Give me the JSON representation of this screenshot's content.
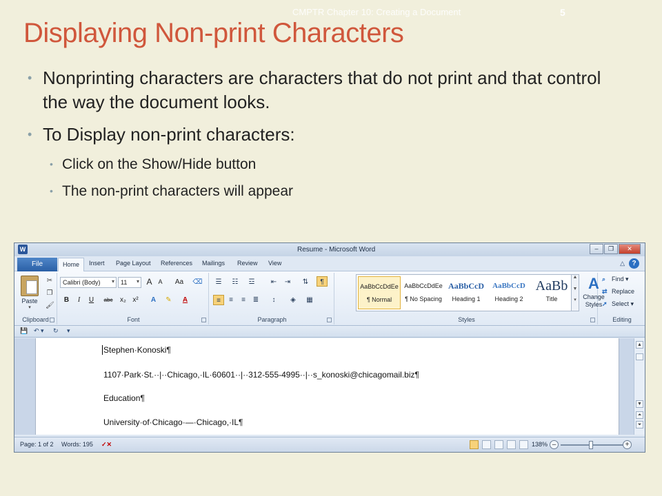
{
  "slide": {
    "footer": "CMPTR Chapter 10: Creating a Document",
    "page_number": "5",
    "title": "Displaying Non-print Characters",
    "bullets": [
      "Nonprinting characters are characters that do not print and that control the way the document looks.",
      "To Display non-print characters:"
    ],
    "sub_bullets": [
      "Click on the Show/Hide button",
      "The non-print characters will appear"
    ]
  },
  "word": {
    "app_icon_letter": "W",
    "title": "Resume - Microsoft Word",
    "tabs": {
      "file": "File",
      "home": "Home",
      "insert": "Insert",
      "page_layout": "Page Layout",
      "references": "References",
      "mailings": "Mailings",
      "review": "Review",
      "view": "View"
    },
    "ribbon": {
      "clipboard": {
        "label": "Clipboard",
        "paste": "Paste"
      },
      "font": {
        "label": "Font",
        "font_name": "Calibri (Body)",
        "font_size": "11",
        "grow": "A",
        "shrink": "A",
        "change_case": "Aa",
        "bold": "B",
        "italic": "I",
        "underline": "U",
        "strikethrough": "abc",
        "subscript": "x₂",
        "superscript": "x²",
        "text_effects": "A",
        "font_color": "A"
      },
      "paragraph": {
        "label": "Paragraph",
        "show_hide": "¶"
      },
      "styles": {
        "label": "Styles",
        "items": [
          {
            "sample": "AaBbCcDdEe",
            "name": "¶ Normal"
          },
          {
            "sample": "AaBbCcDdEe",
            "name": "¶ No Spacing"
          },
          {
            "sample": "AaBbCcD",
            "name": "Heading 1"
          },
          {
            "sample": "AaBbCcD",
            "name": "Heading 2"
          },
          {
            "sample": "AaBb",
            "name": "Title"
          }
        ],
        "change_styles": "Change Styles"
      },
      "editing": {
        "label": "Editing",
        "find": "Find",
        "replace": "Replace",
        "select": "Select"
      }
    },
    "document": {
      "lines": [
        "Stephen·Konoski¶",
        "1107·Park·St.··|··Chicago,·IL·60601··|··312-555-4995··|··s_konoski@chicagomail.biz¶",
        "Education¶",
        "University·of·Chicago·—·Chicago,·IL¶"
      ]
    },
    "status": {
      "page": "Page: 1 of 2",
      "words": "Words: 195",
      "zoom": "138%"
    }
  }
}
